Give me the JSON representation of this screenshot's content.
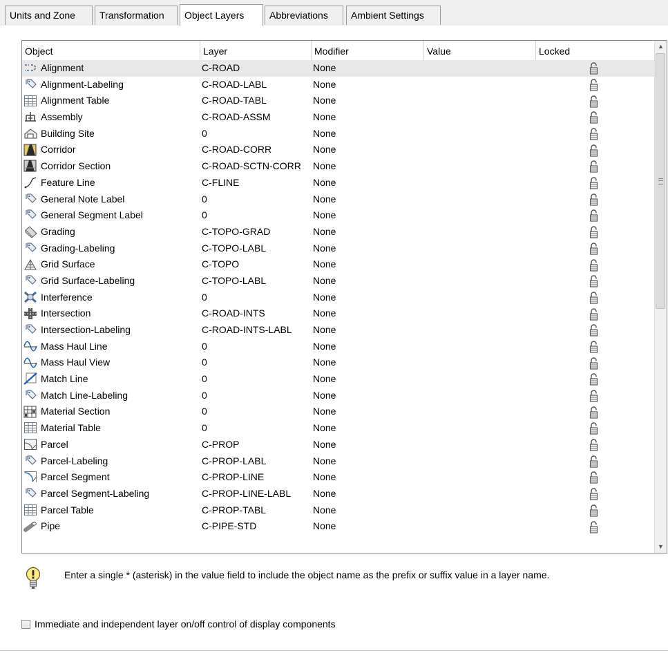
{
  "tabs": [
    {
      "label": "Units and Zone",
      "active": false
    },
    {
      "label": "Transformation",
      "active": false
    },
    {
      "label": "Object Layers",
      "active": true
    },
    {
      "label": "Abbreviations",
      "active": false
    },
    {
      "label": "Ambient Settings",
      "active": false
    }
  ],
  "grid": {
    "columns": [
      "Object",
      "Layer",
      "Modifier",
      "Value",
      "Locked"
    ],
    "rows": [
      {
        "object": "Alignment",
        "icon": "alignment-icon",
        "layer": "C-ROAD",
        "modifier": "None",
        "value": "",
        "locked": "unlocked"
      },
      {
        "object": "Alignment-Labeling",
        "icon": "label-icon",
        "layer": "C-ROAD-LABL",
        "modifier": "None",
        "value": "",
        "locked": "unlocked"
      },
      {
        "object": "Alignment Table",
        "icon": "table-icon",
        "layer": "C-ROAD-TABL",
        "modifier": "None",
        "value": "",
        "locked": "unlocked"
      },
      {
        "object": "Assembly",
        "icon": "assembly-icon",
        "layer": "C-ROAD-ASSM",
        "modifier": "None",
        "value": "",
        "locked": "unlocked"
      },
      {
        "object": "Building Site",
        "icon": "building-site-icon",
        "layer": "0",
        "modifier": "None",
        "value": "",
        "locked": "unlocked"
      },
      {
        "object": "Corridor",
        "icon": "corridor-icon",
        "layer": "C-ROAD-CORR",
        "modifier": "None",
        "value": "",
        "locked": "unlocked"
      },
      {
        "object": "Corridor Section",
        "icon": "corridor-section-icon",
        "layer": "C-ROAD-SCTN-CORR",
        "modifier": "None",
        "value": "",
        "locked": "unlocked"
      },
      {
        "object": "Feature Line",
        "icon": "feature-line-icon",
        "layer": "C-FLINE",
        "modifier": "None",
        "value": "",
        "locked": "unlocked"
      },
      {
        "object": "General Note Label",
        "icon": "label-icon",
        "layer": "0",
        "modifier": "None",
        "value": "",
        "locked": "unlocked"
      },
      {
        "object": "General Segment Label",
        "icon": "label-icon",
        "layer": "0",
        "modifier": "None",
        "value": "",
        "locked": "unlocked"
      },
      {
        "object": "Grading",
        "icon": "grading-icon",
        "layer": "C-TOPO-GRAD",
        "modifier": "None",
        "value": "",
        "locked": "unlocked"
      },
      {
        "object": "Grading-Labeling",
        "icon": "label-icon",
        "layer": "C-TOPO-LABL",
        "modifier": "None",
        "value": "",
        "locked": "unlocked"
      },
      {
        "object": "Grid Surface",
        "icon": "surface-icon",
        "layer": "C-TOPO",
        "modifier": "None",
        "value": "",
        "locked": "unlocked"
      },
      {
        "object": "Grid Surface-Labeling",
        "icon": "label-icon",
        "layer": "C-TOPO-LABL",
        "modifier": "None",
        "value": "",
        "locked": "unlocked"
      },
      {
        "object": "Interference",
        "icon": "interference-icon",
        "layer": "0",
        "modifier": "None",
        "value": "",
        "locked": "unlocked"
      },
      {
        "object": "Intersection",
        "icon": "intersection-icon",
        "layer": "C-ROAD-INTS",
        "modifier": "None",
        "value": "",
        "locked": "unlocked"
      },
      {
        "object": "Intersection-Labeling",
        "icon": "label-icon",
        "layer": "C-ROAD-INTS-LABL",
        "modifier": "None",
        "value": "",
        "locked": "unlocked"
      },
      {
        "object": "Mass Haul Line",
        "icon": "mass-haul-icon",
        "layer": "0",
        "modifier": "None",
        "value": "",
        "locked": "unlocked"
      },
      {
        "object": "Mass Haul View",
        "icon": "mass-haul-icon",
        "layer": "0",
        "modifier": "None",
        "value": "",
        "locked": "unlocked"
      },
      {
        "object": "Match Line",
        "icon": "match-line-icon",
        "layer": "0",
        "modifier": "None",
        "value": "",
        "locked": "unlocked"
      },
      {
        "object": "Match Line-Labeling",
        "icon": "label-icon",
        "layer": "0",
        "modifier": "None",
        "value": "",
        "locked": "unlocked"
      },
      {
        "object": "Material Section",
        "icon": "material-section-icon",
        "layer": "0",
        "modifier": "None",
        "value": "",
        "locked": "unlocked"
      },
      {
        "object": "Material Table",
        "icon": "table-icon",
        "layer": "0",
        "modifier": "None",
        "value": "",
        "locked": "unlocked"
      },
      {
        "object": "Parcel",
        "icon": "parcel-icon",
        "layer": "C-PROP",
        "modifier": "None",
        "value": "",
        "locked": "unlocked"
      },
      {
        "object": "Parcel-Labeling",
        "icon": "label-icon",
        "layer": "C-PROP-LABL",
        "modifier": "None",
        "value": "",
        "locked": "unlocked"
      },
      {
        "object": "Parcel Segment",
        "icon": "parcel-segment-icon",
        "layer": "C-PROP-LINE",
        "modifier": "None",
        "value": "",
        "locked": "unlocked"
      },
      {
        "object": "Parcel Segment-Labeling",
        "icon": "label-icon",
        "layer": "C-PROP-LINE-LABL",
        "modifier": "None",
        "value": "",
        "locked": "unlocked"
      },
      {
        "object": "Parcel Table",
        "icon": "table-icon",
        "layer": "C-PROP-TABL",
        "modifier": "None",
        "value": "",
        "locked": "unlocked"
      },
      {
        "object": "Pipe",
        "icon": "pipe-icon",
        "layer": "C-PIPE-STD",
        "modifier": "None",
        "value": "",
        "locked": "unlocked"
      }
    ]
  },
  "hint": {
    "icon": "lightbulb-icon",
    "text": "Enter a single * (asterisk) in the value field to include the object name as the prefix or suffix value in a layer name."
  },
  "checkbox": {
    "label": "Immediate and independent layer on/off control of display components",
    "checked": false
  },
  "colors": {
    "selected_row": "#e8e8e8",
    "grid_border": "#828790",
    "panel_background": "#ffffff"
  }
}
